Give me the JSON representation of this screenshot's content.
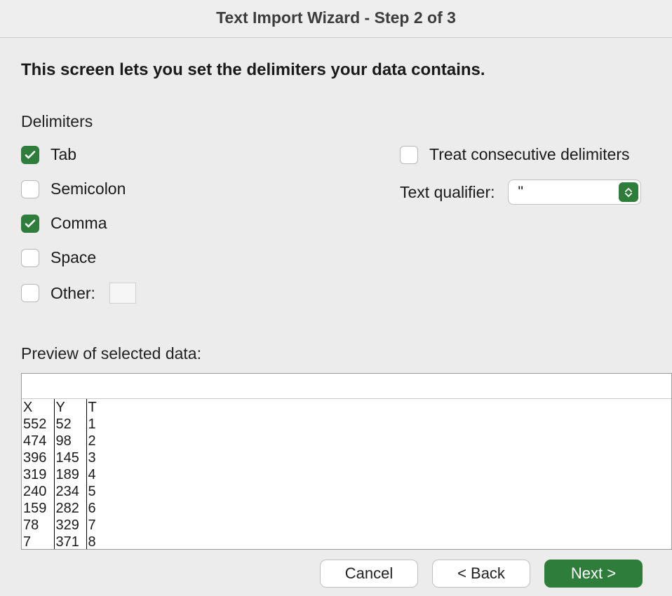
{
  "window": {
    "title": "Text Import Wizard - Step 2 of 3"
  },
  "instruction": "This screen lets you set the delimiters your data contains.",
  "delimiters": {
    "section_label": "Delimiters",
    "tab_label": "Tab",
    "tab_checked": true,
    "semicolon_label": "Semicolon",
    "semicolon_checked": false,
    "comma_label": "Comma",
    "comma_checked": true,
    "space_label": "Space",
    "space_checked": false,
    "other_label": "Other:",
    "other_checked": false,
    "other_value": ""
  },
  "options": {
    "treat_consecutive_label": "Treat consecutive delimiters ",
    "treat_consecutive_checked": false,
    "text_qualifier_label": "Text qualifier:",
    "text_qualifier_value": "\""
  },
  "preview": {
    "label": "Preview of selected data:",
    "columns": [
      "X",
      "Y",
      "T"
    ],
    "rows": [
      [
        "552",
        "52",
        "1"
      ],
      [
        "474",
        "98",
        "2"
      ],
      [
        "396",
        "145",
        "3"
      ],
      [
        "319",
        "189",
        "4"
      ],
      [
        "240",
        "234",
        "5"
      ],
      [
        "159",
        "282",
        "6"
      ],
      [
        "78",
        "329",
        "7"
      ],
      [
        "7",
        "371",
        "8"
      ]
    ]
  },
  "buttons": {
    "cancel": "Cancel",
    "back": "< Back",
    "next": "Next >"
  }
}
